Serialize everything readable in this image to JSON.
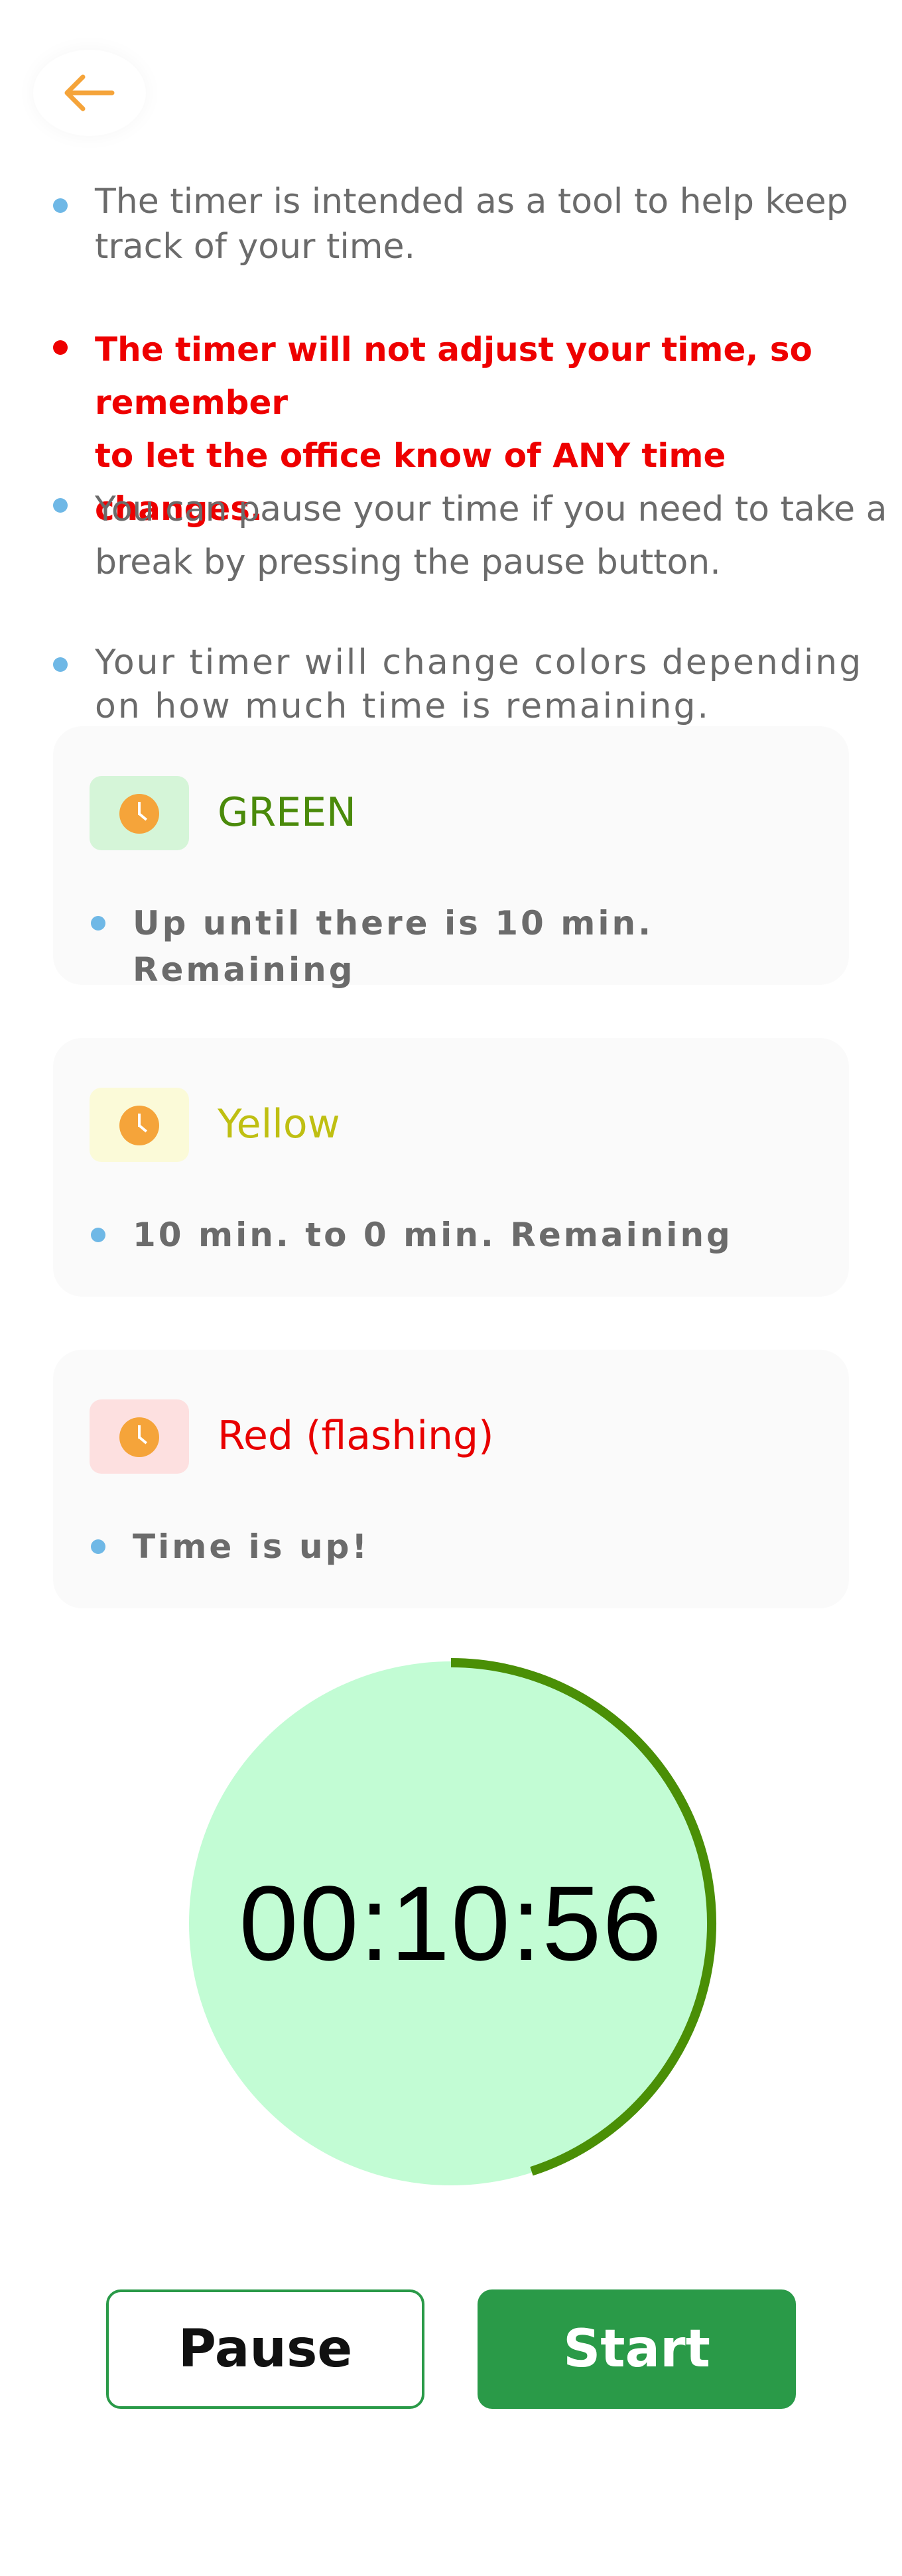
{
  "notes": [
    {
      "text_line1": "The timer is intended as a tool to help keep",
      "text_line2": "track of your time."
    },
    {
      "text_line1": "The timer will not adjust your time, so remember",
      "text_line2": "to let the office know of ANY time changes."
    },
    {
      "text_line1": "You can pause your time if you need to take a",
      "text_line2": "break by pressing the pause button."
    },
    {
      "text_line1": "Your timer will change colors depending",
      "text_line2": "on how much time is remaining."
    }
  ],
  "cards": [
    {
      "title": "GREEN",
      "title_color": "#4a8a0a",
      "chip_color": "#d5f5d8",
      "desc": "Up until there is 10 min. Remaining"
    },
    {
      "title": "Yellow",
      "title_color": "#bfbf12",
      "chip_color": "#fbfad8",
      "desc": "10 min. to 0 min. Remaining"
    },
    {
      "title": "Red (flashing)",
      "title_color": "#e80000",
      "chip_color": "#fde0e0",
      "desc": "Time is up!"
    }
  ],
  "timer": {
    "display": "00:10:56",
    "fill_color": "#c2fcd4",
    "ring_color": "#4a8f06",
    "progress_fraction": 0.45
  },
  "buttons": {
    "pause_label": "Pause",
    "start_label": "Start"
  },
  "colors": {
    "accent": "#f5a43a",
    "bullet": "#6fb8e6",
    "warning": "#ee0000",
    "primary_green": "#2a9a48"
  }
}
